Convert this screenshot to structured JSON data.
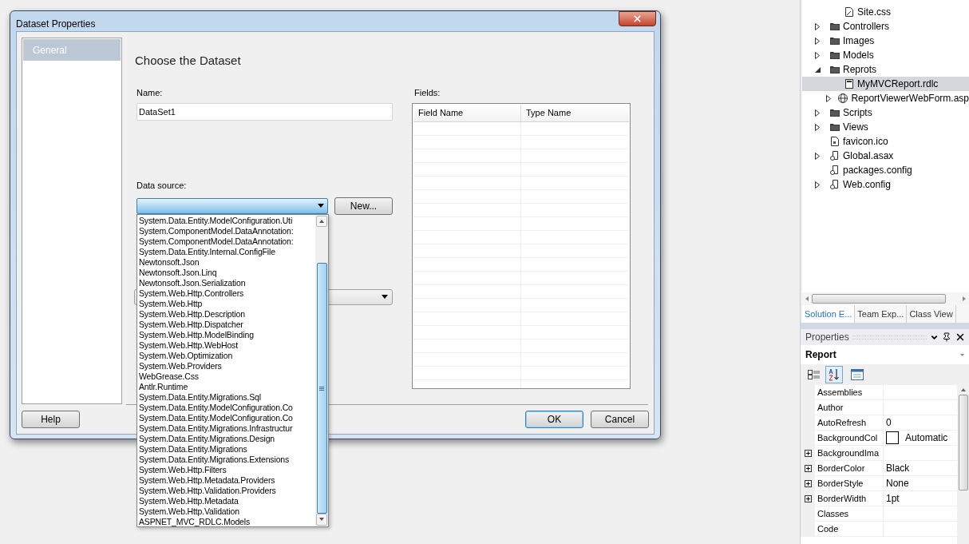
{
  "dialog": {
    "title": "Dataset Properties",
    "nav": [
      {
        "label": "General",
        "selected": true
      }
    ],
    "heading": "Choose the Dataset",
    "name_label": "Name:",
    "name_value": "DataSet1",
    "data_source_label": "Data source:",
    "data_source_open": true,
    "new_button": "New...",
    "data_source_options": [
      "System.Data.Entity.ModelConfiguration.Uti",
      "System.ComponentModel.DataAnnotation:",
      "System.ComponentModel.DataAnnotation:",
      "System.Data.Entity.Internal.ConfigFile",
      "Newtonsoft.Json",
      "Newtonsoft.Json.Linq",
      "Newtonsoft.Json.Serialization",
      "System.Web.Http.Controllers",
      "System.Web.Http",
      "System.Web.Http.Description",
      "System.Web.Http.Dispatcher",
      "System.Web.Http.ModelBinding",
      "System.Web.Http.WebHost",
      "System.Web.Optimization",
      "System.Web.Providers",
      "WebGrease.Css",
      "Antlr.Runtime",
      "System.Data.Entity.Migrations.Sql",
      "System.Data.Entity.ModelConfiguration.Co",
      "System.Data.Entity.ModelConfiguration.Co",
      "System.Data.Entity.Migrations.Infrastructur",
      "System.Data.Entity.Migrations.Design",
      "System.Data.Entity.Migrations",
      "System.Data.Entity.Migrations.Extensions",
      "System.Web.Http.Filters",
      "System.Web.Http.Metadata.Providers",
      "System.Web.Http.Validation.Providers",
      "System.Web.Http.Metadata",
      "System.Web.Http.Validation",
      "ASPNET_MVC_RDLC.Models"
    ],
    "fields_label": "Fields:",
    "fields_columns": [
      "Field Name",
      "Type Name"
    ],
    "buttons": {
      "help": "Help",
      "ok": "OK",
      "cancel": "Cancel"
    }
  },
  "solution_explorer": {
    "scrolled_branch": [
      {
        "label": "Site.css",
        "kind": "stylesheet",
        "expandable": false,
        "expanded": false,
        "selected": false
      }
    ],
    "tree": [
      {
        "label": "Controllers",
        "kind": "folder",
        "expandable": true,
        "expanded": false,
        "selected": false
      },
      {
        "label": "Images",
        "kind": "folder",
        "expandable": true,
        "expanded": false,
        "selected": false
      },
      {
        "label": "Models",
        "kind": "folder",
        "expandable": true,
        "expanded": false,
        "selected": false
      },
      {
        "label": "Reprots",
        "kind": "folder",
        "expandable": true,
        "expanded": true,
        "selected": false,
        "children": [
          {
            "label": "MyMVCReport.rdlc",
            "kind": "report",
            "expandable": false,
            "expanded": false,
            "selected": true
          },
          {
            "label": "ReportViewerWebForm.asp",
            "kind": "webform",
            "expandable": true,
            "expanded": false,
            "selected": false
          }
        ]
      },
      {
        "label": "Scripts",
        "kind": "folder",
        "expandable": true,
        "expanded": false,
        "selected": false
      },
      {
        "label": "Views",
        "kind": "folder",
        "expandable": true,
        "expanded": false,
        "selected": false
      },
      {
        "label": "favicon.ico",
        "kind": "image",
        "expandable": false,
        "expanded": false,
        "selected": false
      },
      {
        "label": "Global.asax",
        "kind": "config",
        "expandable": true,
        "expanded": false,
        "selected": false
      },
      {
        "label": "packages.config",
        "kind": "config",
        "expandable": false,
        "expanded": false,
        "selected": false
      },
      {
        "label": "Web.config",
        "kind": "config",
        "expandable": true,
        "expanded": false,
        "selected": false
      }
    ],
    "tabs": [
      {
        "label": "Solution E...",
        "selected": true
      },
      {
        "label": "Team Exp...",
        "selected": false
      },
      {
        "label": "Class View",
        "selected": false
      }
    ]
  },
  "properties": {
    "title": "Properties",
    "object": "Report",
    "toolbar": [
      {
        "kind": "categorized",
        "selected": false
      },
      {
        "kind": "alphabetical",
        "selected": true
      },
      {
        "kind": "pages",
        "selected": false
      }
    ],
    "rows": [
      {
        "name": "Assemblies",
        "kind": "text",
        "expandable": false
      },
      {
        "name": "Author",
        "kind": "text",
        "expandable": false
      },
      {
        "name": "AutoRefresh",
        "kind": "text",
        "expandable": false,
        "value": "0"
      },
      {
        "name": "BackgroundCol",
        "kind": "color",
        "expandable": false,
        "value": "Automatic"
      },
      {
        "name": "BackgroundIma",
        "kind": "text",
        "expandable": true
      },
      {
        "name": "BorderColor",
        "kind": "text",
        "expandable": true,
        "value": "Black"
      },
      {
        "name": "BorderStyle",
        "kind": "text",
        "expandable": true,
        "value": "None"
      },
      {
        "name": "BorderWidth",
        "kind": "text",
        "expandable": true,
        "value": "1pt"
      },
      {
        "name": "Classes",
        "kind": "text",
        "expandable": false
      },
      {
        "name": "Code",
        "kind": "text",
        "expandable": false
      }
    ]
  }
}
